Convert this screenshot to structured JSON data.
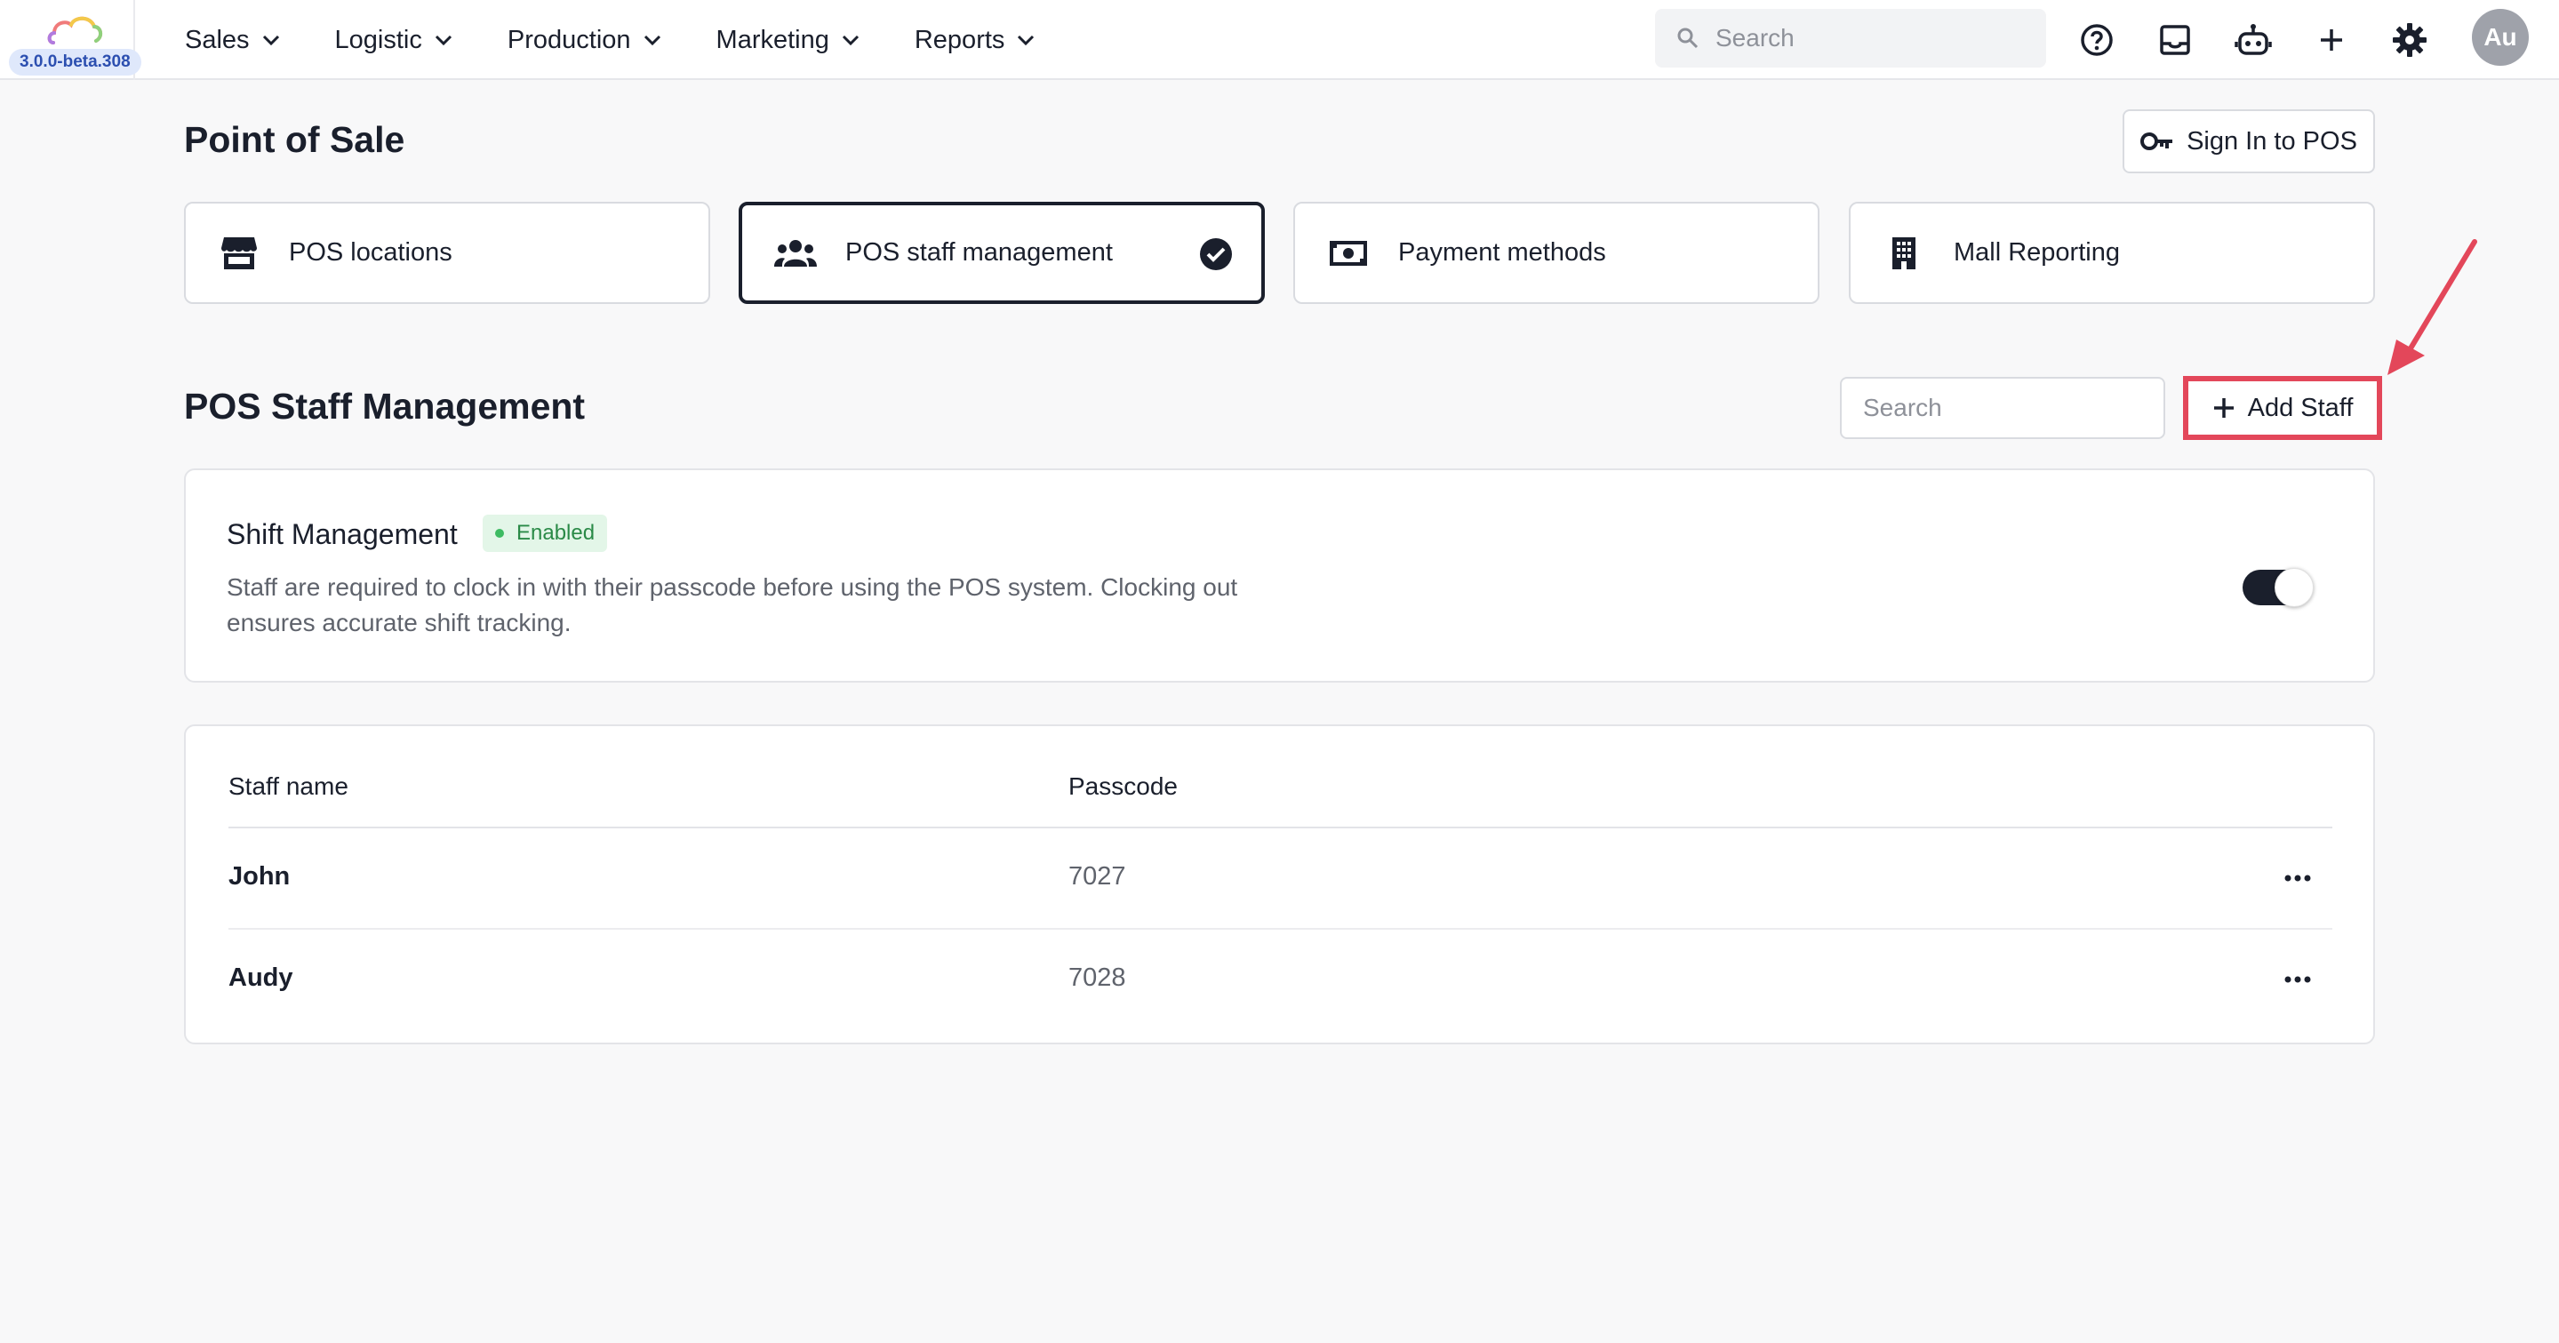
{
  "app": {
    "version": "3.0.0-beta.308",
    "logo_icon": "cloud-logo-icon"
  },
  "nav": {
    "items": [
      {
        "label": "Sales",
        "icon": "chevron-down-icon"
      },
      {
        "label": "Logistic",
        "icon": "chevron-down-icon"
      },
      {
        "label": "Production",
        "icon": "chevron-down-icon"
      },
      {
        "label": "Marketing",
        "icon": "chevron-down-icon"
      },
      {
        "label": "Reports",
        "icon": "chevron-down-icon"
      }
    ],
    "search_placeholder": "Search",
    "icons": [
      "help-icon",
      "inbox-icon",
      "bot-icon",
      "plus-icon",
      "gear-icon"
    ],
    "avatar_initials": "Au"
  },
  "page": {
    "title": "Point of Sale",
    "signin_label": "Sign In to POS"
  },
  "tabs": [
    {
      "label": "POS locations",
      "icon": "store-icon",
      "active": false
    },
    {
      "label": "POS staff management",
      "icon": "people-icon",
      "active": true
    },
    {
      "label": "Payment methods",
      "icon": "cash-icon",
      "active": false
    },
    {
      "label": "Mall Reporting",
      "icon": "building-icon",
      "active": false
    }
  ],
  "staff": {
    "title": "POS Staff Management",
    "search_placeholder": "Search",
    "add_label": "Add Staff",
    "shift": {
      "title": "Shift Management",
      "badge": "Enabled",
      "description": "Staff are required to clock in with their passcode before using the POS system. Clocking out ensures accurate shift tracking.",
      "enabled": true
    },
    "table": {
      "headers": [
        "Staff name",
        "Passcode"
      ],
      "rows": [
        {
          "name": "John",
          "passcode": "7027"
        },
        {
          "name": "Audy",
          "passcode": "7028"
        }
      ]
    }
  },
  "colors": {
    "accent_dark": "#1a1f2c",
    "highlight_red": "#e3475a",
    "badge_green": "#2a8a47"
  }
}
